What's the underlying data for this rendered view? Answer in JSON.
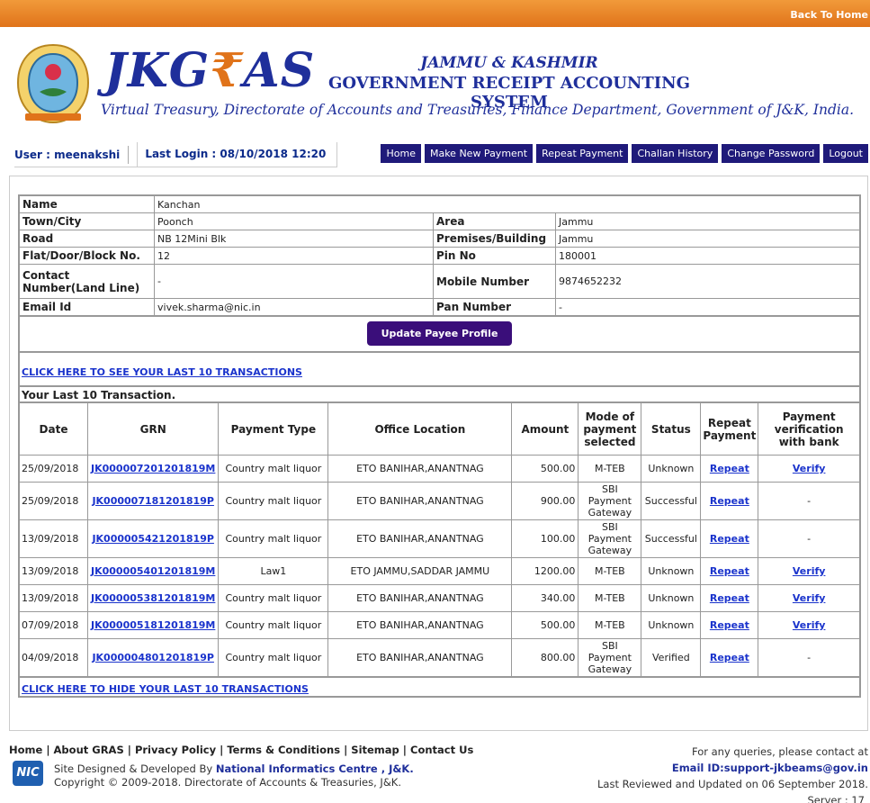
{
  "topbar": {
    "back_home": "Back To Home"
  },
  "header": {
    "brand_pre": "JKG",
    "brand_post": "AS",
    "state": "JAMMU & KASHMIR",
    "system": "GOVERNMENT RECEIPT ACCOUNTING SYSTEM",
    "tagline": "Virtual Treasury, Directorate of Accounts and Treasuries, Finance Department, Government of J&K, India."
  },
  "user": {
    "label": "User : meenakshi",
    "last_login": "Last Login : 08/10/2018 12:20"
  },
  "nav": [
    "Home",
    "Make New Payment",
    "Repeat Payment",
    "Challan History",
    "Change Password",
    "Logout"
  ],
  "profile": {
    "name_label": "Name",
    "name": "Kanchan",
    "town_label": "Town/City",
    "town": "Poonch",
    "area_label": "Area",
    "area": "Jammu",
    "road_label": "Road",
    "road": "NB 12Mini Blk",
    "premises_label": "Premises/Building",
    "premises": "Jammu",
    "flat_label": "Flat/Door/Block No.",
    "flat": "12",
    "pin_label": "Pin No",
    "pin": "180001",
    "contact_label": "Contact Number(Land Line)",
    "contact": "-",
    "mobile_label": "Mobile Number",
    "mobile": "9874652232",
    "email_label": "Email Id",
    "email": "vivek.sharma@nic.in",
    "pan_label": "Pan Number",
    "pan": "-",
    "update_button": "Update Payee Profile",
    "show_link": "CLICK HERE TO SEE YOUR LAST 10 TRANSACTIONS"
  },
  "transactions": {
    "section_title": "Your Last 10 Transaction.",
    "headers": [
      "Date",
      "GRN",
      "Payment Type",
      "Office Location",
      "Amount",
      "Mode of payment selected",
      "Status",
      "Repeat Payment",
      "Payment verification with bank"
    ],
    "rows": [
      [
        "25/09/2018",
        "JK000007201201819M",
        "Country malt liquor",
        "ETO BANIHAR,ANANTNAG",
        "500.00",
        "M-TEB",
        "Unknown",
        "Repeat",
        "Verify"
      ],
      [
        "25/09/2018",
        "JK000007181201819P",
        "Country malt liquor",
        "ETO BANIHAR,ANANTNAG",
        "900.00",
        "SBI Payment Gateway",
        "Successful",
        "Repeat",
        "-"
      ],
      [
        "13/09/2018",
        "JK000005421201819P",
        "Country malt liquor",
        "ETO BANIHAR,ANANTNAG",
        "100.00",
        "SBI Payment Gateway",
        "Successful",
        "Repeat",
        "-"
      ],
      [
        "13/09/2018",
        "JK000005401201819M",
        "Law1",
        "ETO JAMMU,SADDAR JAMMU",
        "1200.00",
        "M-TEB",
        "Unknown",
        "Repeat",
        "Verify"
      ],
      [
        "13/09/2018",
        "JK000005381201819M",
        "Country malt liquor",
        "ETO BANIHAR,ANANTNAG",
        "340.00",
        "M-TEB",
        "Unknown",
        "Repeat",
        "Verify"
      ],
      [
        "07/09/2018",
        "JK000005181201819M",
        "Country malt liquor",
        "ETO BANIHAR,ANANTNAG",
        "500.00",
        "M-TEB",
        "Unknown",
        "Repeat",
        "Verify"
      ],
      [
        "04/09/2018",
        "JK000004801201819P",
        "Country malt liquor",
        "ETO BANIHAR,ANANTNAG",
        "800.00",
        "SBI Payment Gateway",
        "Verified",
        "Repeat",
        "-"
      ]
    ],
    "hide_link": "CLICK HERE TO HIDE YOUR LAST 10 TRANSACTIONS"
  },
  "footer": {
    "links": [
      "Home",
      "About GRAS",
      "Privacy Policy",
      "Terms & Conditions",
      "Sitemap",
      "Contact Us"
    ],
    "nic_logo": "NIC",
    "designed_by": "Site Designed & Developed By",
    "nic_name": "National Informatics Centre , J&K.",
    "copyright": "Copyright © 2009-2018. Directorate of Accounts & Treasuries, J&K.",
    "queries": "For any queries, please contact at",
    "email": "Email ID:support-jkbeams@gov.in",
    "reviewed": "Last Reviewed and Updated on 06 September 2018.",
    "server": "Server : 17"
  }
}
